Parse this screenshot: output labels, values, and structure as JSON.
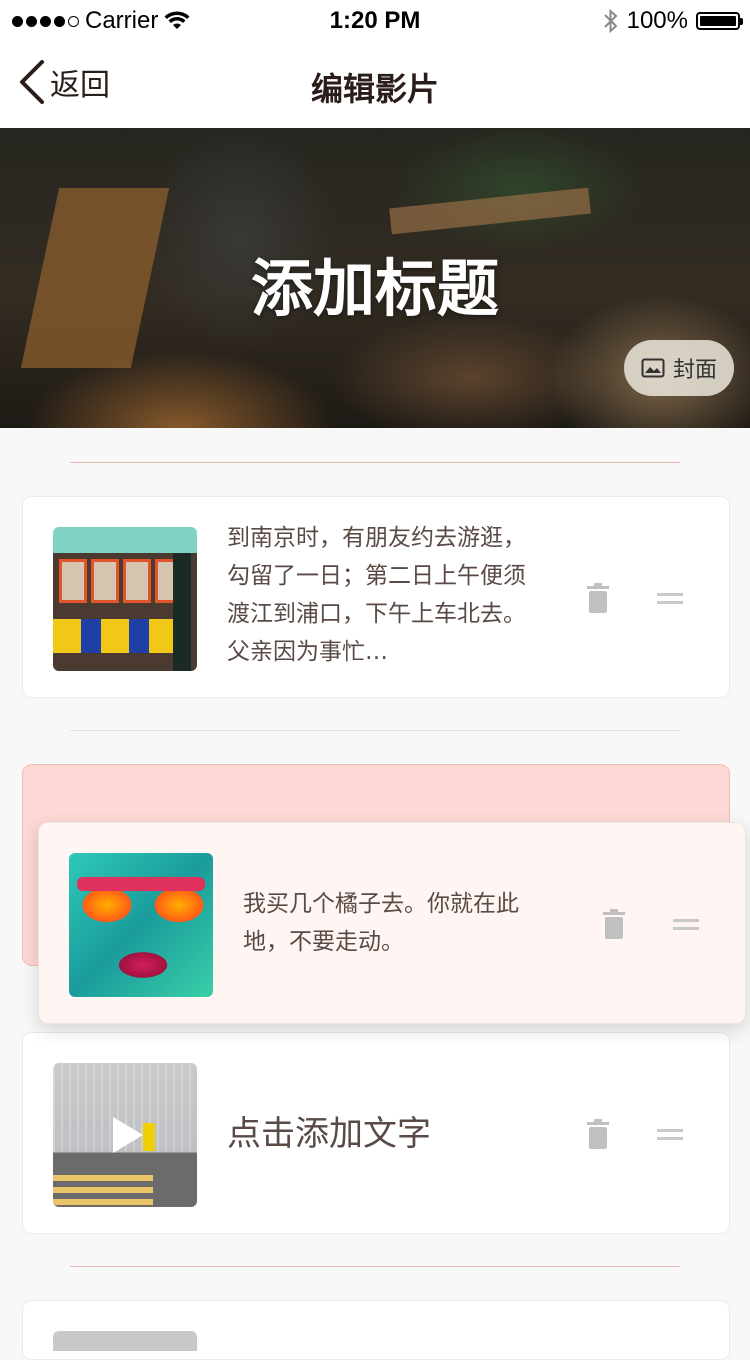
{
  "status_bar": {
    "carrier": "Carrier",
    "time": "1:20 PM",
    "battery": "100%",
    "signal_icon": "signal-dots-icon",
    "wifi_icon": "wifi-icon",
    "bluetooth_icon": "bluetooth-icon"
  },
  "nav": {
    "back_label": "返回",
    "title": "编辑影片"
  },
  "hero": {
    "title": "添加标题",
    "cover_button": "封面"
  },
  "items": [
    {
      "text": "到南京时，有朋友约去游逛，勾留了一日；第二日上午便须渡江到浦口，下午上车北去。父亲因为事忙…",
      "thumb": "shop-front-photo",
      "type": "image"
    },
    {
      "text": "我买几个橘子去。你就在此地，不要走动。",
      "thumb": "graffiti-face-photo",
      "type": "image",
      "state": "dragging"
    },
    {
      "text": "点击添加文字",
      "thumb": "street-runner-video",
      "type": "video"
    }
  ],
  "colors": {
    "accent_pink": "#fdd8d4",
    "divider_pink": "#e8b9b0",
    "text_dark": "#2a1d1a"
  }
}
